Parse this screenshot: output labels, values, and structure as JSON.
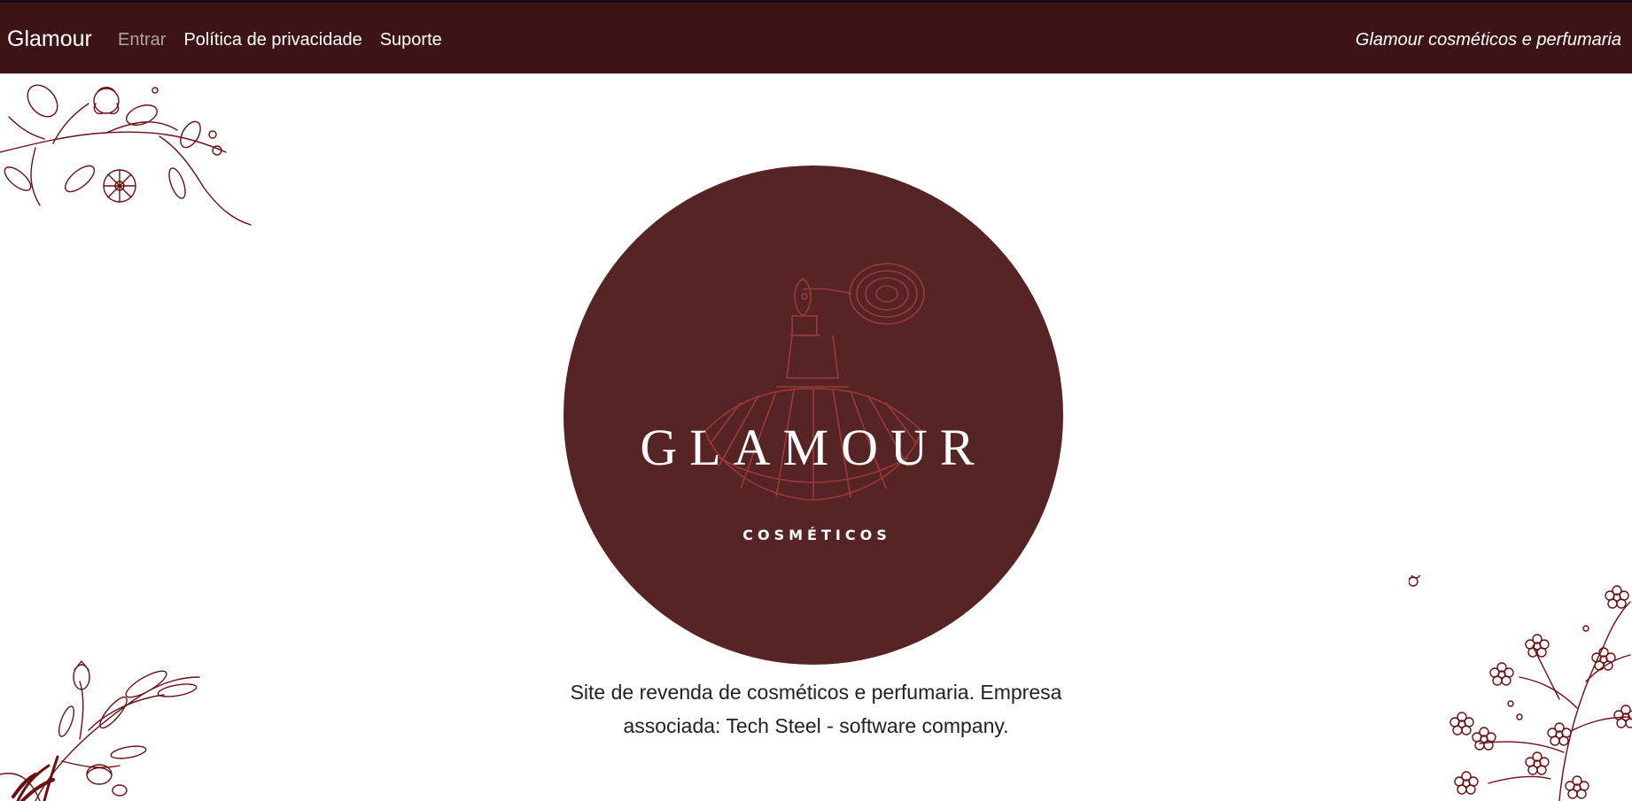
{
  "nav": {
    "brand": "Glamour",
    "links": [
      {
        "label": "Entrar"
      },
      {
        "label": "Política de privacidade"
      },
      {
        "label": "Suporte"
      }
    ],
    "tagline": "Glamour cosméticos e perfumaria"
  },
  "logo": {
    "title": "GLAMOUR",
    "subtitle": "COSMÉTICOS",
    "icon": "perfume-bottle-icon"
  },
  "description": "Site de revenda de cosméticos e perfumaria. Empresa associada: Tech Steel - software company.",
  "colors": {
    "navbar": "#3d1416",
    "logo_circle": "#572426",
    "floral": "#6b0f14",
    "bottle_lines": "#9a3a38"
  }
}
